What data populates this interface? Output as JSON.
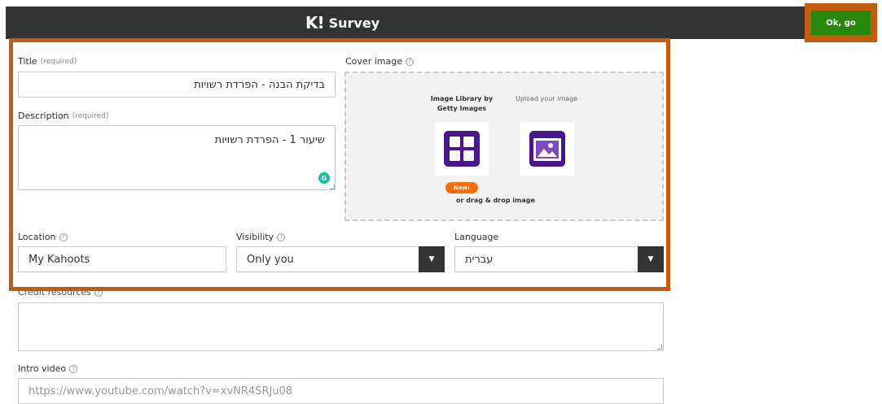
{
  "header": {
    "logo_k": "K!",
    "logo_text": "Survey",
    "ok_button": "Ok, go"
  },
  "form": {
    "title": {
      "label": "Title",
      "required": "(required)",
      "value": "בדיקת הבנה - הפרדת רשויות"
    },
    "description": {
      "label": "Description",
      "required": "(required)",
      "value": "שיעור 1 - הפרדת רשויות"
    },
    "cover": {
      "label": "Cover image",
      "library_line1": "Image Library by",
      "library_line2": "Getty Images",
      "upload": "Upload your image",
      "new_badge": "New!",
      "drag": "or drag & drop image"
    },
    "location": {
      "label": "Location",
      "value": "My Kahoots"
    },
    "visibility": {
      "label": "Visibility",
      "value": "Only you"
    },
    "language": {
      "label": "Language",
      "value": "עברית"
    },
    "credit": {
      "label": "Credit resources"
    },
    "intro_video": {
      "label": "Intro video",
      "placeholder": "https://www.youtube.com/watch?v=xvNR4SRJu08"
    }
  },
  "colors": {
    "header_bg": "#333333",
    "ok_green": "#26890c",
    "highlight": "#c55a11",
    "icon_purple": "#46178f",
    "new_orange": "#ff6b00"
  },
  "icons": {
    "library": "grid-icon",
    "upload": "image-upload-icon",
    "help": "help-circle-icon",
    "dropdown": "caret-down-icon",
    "grammarly": "grammarly-icon"
  }
}
